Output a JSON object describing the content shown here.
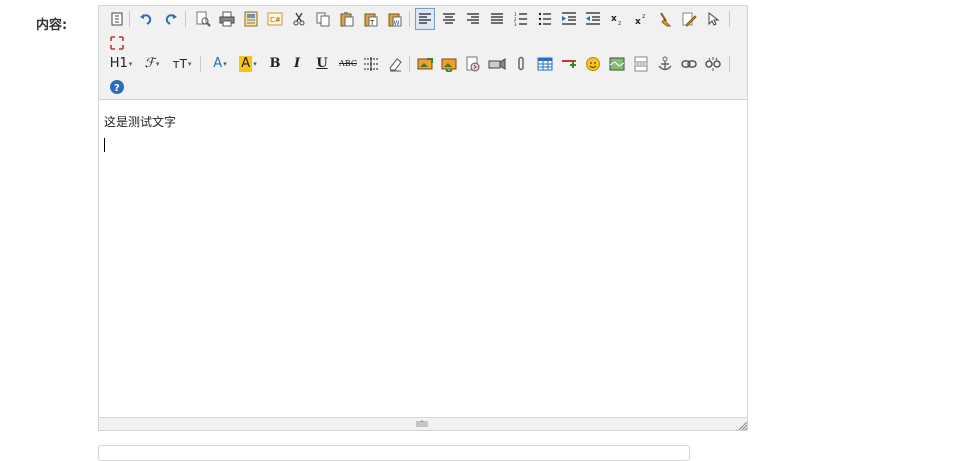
{
  "form": {
    "content_label": "内容:"
  },
  "editor": {
    "content_text": "这是测试文字",
    "toolbar_row1": [
      {
        "name": "source-icon",
        "state": "normal"
      },
      {
        "name": "undo-icon"
      },
      {
        "name": "redo-icon"
      },
      {
        "name": "preview-icon"
      },
      {
        "name": "print-icon"
      },
      {
        "name": "template-icon"
      },
      {
        "name": "code-icon"
      },
      {
        "name": "cut-icon"
      },
      {
        "name": "copy-icon"
      },
      {
        "name": "paste-icon"
      },
      {
        "name": "paste-plaintext-icon"
      },
      {
        "name": "paste-word-icon"
      },
      {
        "name": "align-left-icon",
        "state": "active"
      },
      {
        "name": "align-center-icon"
      },
      {
        "name": "align-right-icon"
      },
      {
        "name": "align-justify-icon"
      },
      {
        "name": "ordered-list-icon"
      },
      {
        "name": "unordered-list-icon"
      },
      {
        "name": "indent-icon"
      },
      {
        "name": "outdent-icon"
      },
      {
        "name": "subscript-icon"
      },
      {
        "name": "superscript-icon"
      },
      {
        "name": "clear-format-icon"
      },
      {
        "name": "quickformat-icon"
      },
      {
        "name": "select-all-icon"
      },
      {
        "name": "fullscreen-icon"
      }
    ],
    "toolbar_row2": [
      {
        "name": "heading-icon",
        "label": "H1"
      },
      {
        "name": "font-family-icon",
        "label": "ℱ"
      },
      {
        "name": "font-size-icon",
        "label": "тT"
      },
      {
        "name": "font-color-icon",
        "label": "A"
      },
      {
        "name": "highlight-color-icon",
        "label": "A"
      },
      {
        "name": "bold-icon",
        "label": "B"
      },
      {
        "name": "italic-icon",
        "label": "I"
      },
      {
        "name": "underline-icon",
        "label": "U"
      },
      {
        "name": "strikethrough-icon",
        "label": "ABC"
      },
      {
        "name": "line-height-icon"
      },
      {
        "name": "remove-format-icon"
      },
      {
        "name": "image-icon"
      },
      {
        "name": "multi-image-icon"
      },
      {
        "name": "flash-icon"
      },
      {
        "name": "media-icon"
      },
      {
        "name": "attachment-icon"
      },
      {
        "name": "table-icon"
      },
      {
        "name": "horizontal-rule-icon"
      },
      {
        "name": "emoticon-icon"
      },
      {
        "name": "baidu-map-icon"
      },
      {
        "name": "page-break-icon"
      },
      {
        "name": "anchor-icon"
      },
      {
        "name": "link-icon"
      },
      {
        "name": "unlink-icon"
      },
      {
        "name": "help-icon"
      }
    ],
    "colors": {
      "toolbar_bg": "#f1f1f1",
      "border": "#d4d4d4",
      "active_border": "#7a9cc8",
      "highlight_yellow": "#f5c518",
      "font_color_blue": "#2a6ebb"
    }
  }
}
